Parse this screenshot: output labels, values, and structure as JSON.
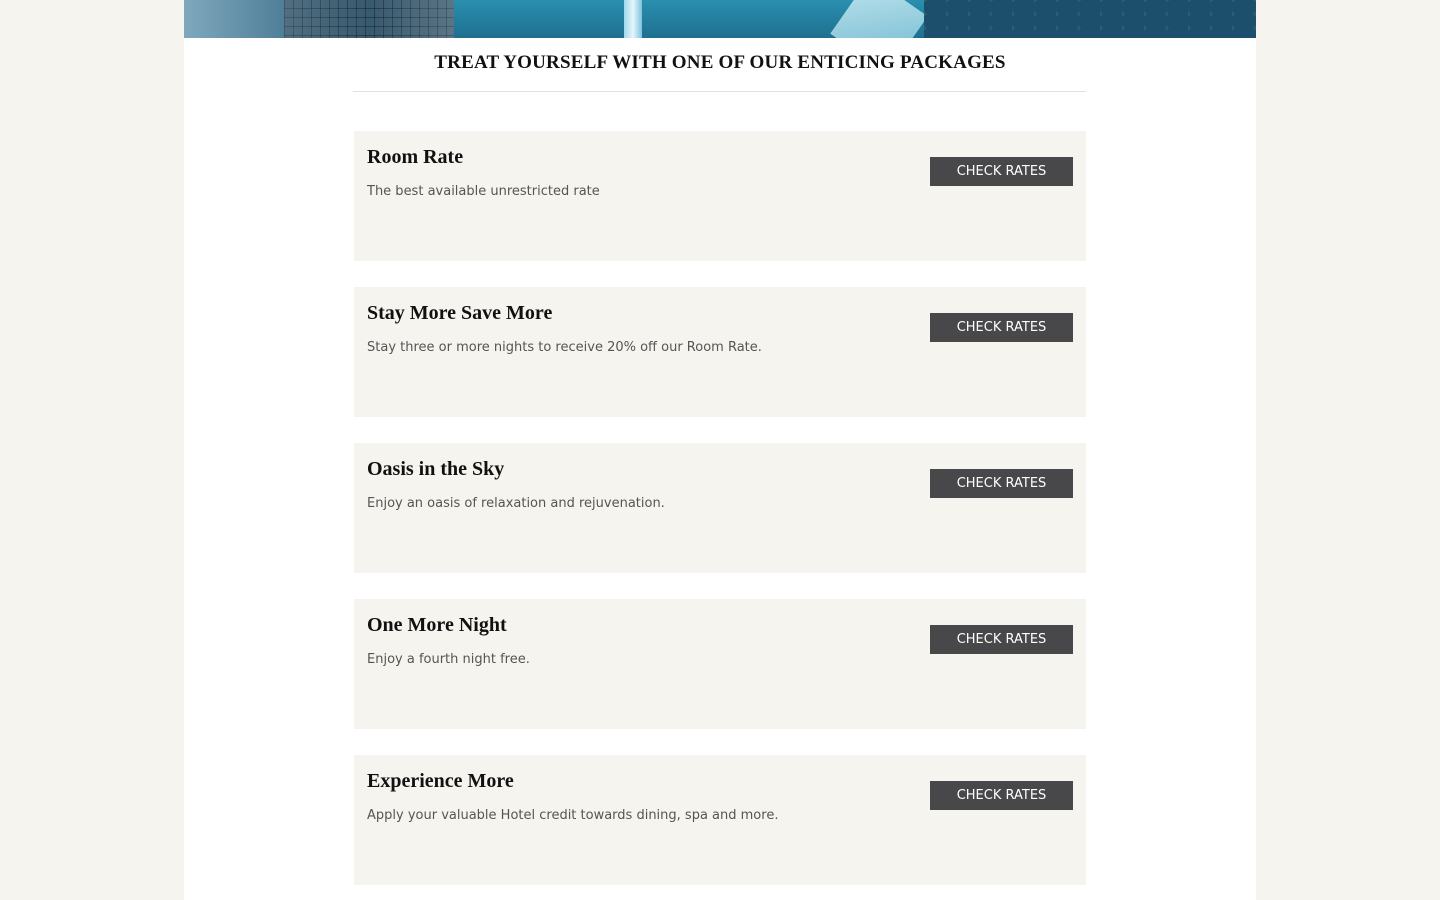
{
  "section_title": "TREAT YOURSELF WITH ONE OF OUR ENTICING PACKAGES",
  "packages": [
    {
      "name": "Room Rate",
      "description": "The best available unrestricted rate",
      "button_label": "CHECK RATES"
    },
    {
      "name": "Stay More Save More",
      "description": "Stay three or more nights to receive 20% off our Room Rate.",
      "button_label": "CHECK RATES"
    },
    {
      "name": "Oasis in the Sky",
      "description": "Enjoy an oasis of relaxation and rejuvenation.",
      "button_label": "CHECK RATES"
    },
    {
      "name": "One More Night",
      "description": "Enjoy a fourth night free.",
      "button_label": "CHECK RATES"
    },
    {
      "name": "Experience More",
      "description": "Apply your valuable Hotel credit towards dining, spa and more.",
      "button_label": "CHECK RATES"
    }
  ],
  "colors": {
    "page_background": "#f5f4ee",
    "content_background": "#ffffff",
    "card_background": "#f5f4ee",
    "button_background": "#48484a",
    "button_text": "#ffffff",
    "heading_text": "#111111",
    "body_text": "#555555"
  }
}
